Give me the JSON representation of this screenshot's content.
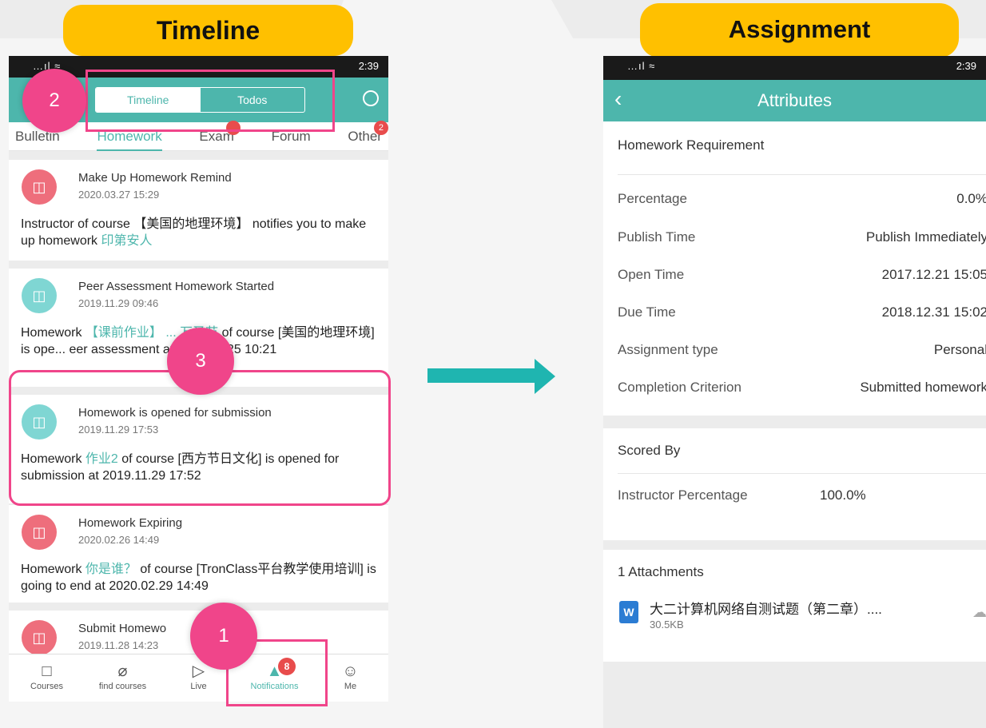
{
  "labels": {
    "left": "Timeline",
    "right": "Assignment"
  },
  "left": {
    "status_time": "2:39",
    "status_sig": "…ıl ≈",
    "toggle": {
      "timeline": "Timeline",
      "todos": "Todos"
    },
    "tabs": [
      "Bulletin",
      "Homework",
      "Exam",
      "Forum",
      "Other"
    ],
    "tab_badges": {
      "exam": "",
      "other": "2"
    },
    "cards": [
      {
        "title": "Make Up Homework Remind",
        "date": "2020.03.27 15:29",
        "pre": "Instructor of course 【美国的地理环境】 notifies you to make up homework ",
        "hl": "印第安人",
        "post": ""
      },
      {
        "title": "Peer Assessment Homework Started",
        "date": "2019.11.29 09:46",
        "pre": "Homework ",
        "hl": "【课前作业】 ... 万圣节",
        "post": " of course [美国的地理环境] is ope... eer assessment at 2020.03.25 10:21"
      },
      {
        "title": "Homework is opened for submission",
        "date": "2019.11.29 17:53",
        "pre": "Homework ",
        "hl": "作业2",
        "post": " of course [西方节日文化] is opened for submission at 2019.11.29 17:52"
      },
      {
        "title": "Homework Expiring",
        "date": "2020.02.26 14:49",
        "pre": "Homework ",
        "hl": "你是谁？",
        "post": " of course [TronClass平台教学使用培训] is going to end at 2020.02.29 14:49"
      },
      {
        "title": "Submit Homewo",
        "date": "2019.11.28 14:23",
        "pre": "",
        "hl": "",
        "post": ""
      }
    ],
    "nav": [
      {
        "label": "Courses",
        "glyph": "□"
      },
      {
        "label": "find courses",
        "glyph": "⌀"
      },
      {
        "label": "Live",
        "glyph": "▷"
      },
      {
        "label": "Notifications",
        "glyph": "▲"
      },
      {
        "label": "Me",
        "glyph": "☺"
      }
    ],
    "nav_badge": "8"
  },
  "right": {
    "status_time": "2:39",
    "status_sig": "…ıl ≈",
    "title": "Attributes",
    "req_header": "Homework Requirement",
    "rows": [
      {
        "k": "Percentage",
        "v": "0.0%"
      },
      {
        "k": "Publish Time",
        "v": "Publish Immediately"
      },
      {
        "k": "Open Time",
        "v": "2017.12.21 15:05"
      },
      {
        "k": "Due Time",
        "v": "2018.12.31 15:02"
      },
      {
        "k": "Assignment type",
        "v": "Personal"
      },
      {
        "k": "Completion Criterion",
        "v": "Submitted homework"
      }
    ],
    "scored_header": "Scored By",
    "scored_row": {
      "k": "Instructor   Percentage",
      "v": "100.0%"
    },
    "attach_header": "1 Attachments",
    "file": {
      "name": "大二计算机网络自测试题（第二章）....",
      "size": "30.5KB",
      "icon": "W"
    }
  },
  "markers": [
    "1",
    "2",
    "3"
  ],
  "colors": {
    "accent": "#4db6ac",
    "highlight": "#f0458a",
    "label": "#ffc000"
  }
}
